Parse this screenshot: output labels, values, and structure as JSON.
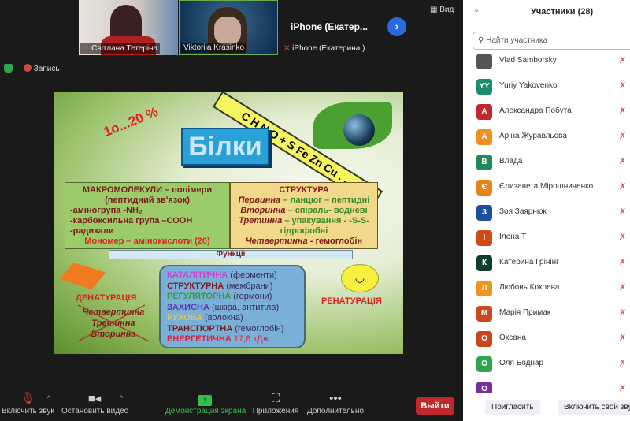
{
  "thumbnails": [
    {
      "name": "Світлана Тетеріна"
    },
    {
      "name": "Viktoriia Krasinko"
    },
    {
      "title": "iPhone  (Екатер...",
      "name": "iPhone (Екатерина )"
    }
  ],
  "view_label": "Вид",
  "recording_label": "Запись",
  "slide": {
    "percent": "1о...20 %",
    "elements": "C H N O + S Fe Zn Cu . . .",
    "title": "Білки",
    "left_box": [
      "МАКРОМОЛЕКУЛИ – полімери",
      "(пептидний зв'язок)",
      "-аміногрупа -NH₂",
      "-карбоксильна група –СООН",
      "-радикали",
      "Мономер – амінокислоти (20)"
    ],
    "right_box": {
      "title": "СТРУКТУРА",
      "lines": [
        [
          "Первинна",
          " – ланцюг – пептидні"
        ],
        [
          "Вторинна",
          " – спіраль- водневі"
        ],
        [
          "Третинна",
          " – упакування - -S-S-"
        ],
        [
          "",
          " гідрофобні"
        ],
        [
          "Четвертинна",
          " - гемоглобін"
        ]
      ]
    },
    "functions_label": "Функції",
    "functions": [
      [
        "КАТАЛІТИЧНА",
        " (ферменти)",
        "#d040d0"
      ],
      [
        "СТРУКТУРНА",
        " (мембрани)",
        "#7a1a1a"
      ],
      [
        "РЕГУЛЯТОРНА",
        " (гормони)",
        "#3a9a3a"
      ],
      [
        "ЗАХИСНА",
        " (шкіра, антитіла)",
        "#5a3ab0"
      ],
      [
        "РУХОВА",
        " (волокна)",
        "#f0c040"
      ],
      [
        "ТРАНСПОРТНА",
        " (гемоглобін)",
        "#7a1a1a"
      ],
      [
        "ЕНЕРГЕТИЧНА",
        " 17,6 кДж",
        "#e02040"
      ]
    ],
    "denaturation": "ДЕНАТУРАЦІЯ",
    "denat_list": [
      "Четвертинна",
      "Третинна",
      "Вторинна"
    ],
    "renaturation": "РЕНАТУРАЦІЯ"
  },
  "panel": {
    "title": "Участники (28)",
    "search_placeholder": "Найти участника",
    "participants": [
      {
        "initials": "",
        "name": "Vlad Samborsky",
        "color": "#555555"
      },
      {
        "initials": "YY",
        "name": "Yuriy Yakovenko",
        "color": "#1e8a6e"
      },
      {
        "initials": "А",
        "name": "Александра Побута",
        "color": "#c0282b"
      },
      {
        "initials": "А",
        "name": "Аріна Журавльова",
        "color": "#f0901e"
      },
      {
        "initials": "В",
        "name": "Влада",
        "color": "#1f8a5a"
      },
      {
        "initials": "Є",
        "name": "Єлизавета Мірошниченко",
        "color": "#e8841c"
      },
      {
        "initials": "З",
        "name": "Зоя Заярнюк",
        "color": "#1c4fa0"
      },
      {
        "initials": "І",
        "name": "Ілона Т",
        "color": "#d04a14"
      },
      {
        "initials": "К",
        "name": "Катерина Грінінг",
        "color": "#0f3d30"
      },
      {
        "initials": "Л",
        "name": "Любовь Кокоева",
        "color": "#f0961e"
      },
      {
        "initials": "М",
        "name": "Марія Примак",
        "color": "#c84a1e"
      },
      {
        "initials": "О",
        "name": "Оксана",
        "color": "#c8461a"
      },
      {
        "initials": "О",
        "name": "Оля Боднар",
        "color": "#2ea44f"
      },
      {
        "initials": "О",
        "name": "",
        "color": "#7a2ea0"
      }
    ],
    "invite": "Пригласить",
    "unmute_self": "Включить свой звук"
  },
  "toolbar": {
    "unmute": "Включить звук",
    "stop_video": "Остановить видео",
    "share": "Демонстрация экрана",
    "apps": "Приложения",
    "more": "Дополнительно",
    "leave": "Выйти"
  }
}
